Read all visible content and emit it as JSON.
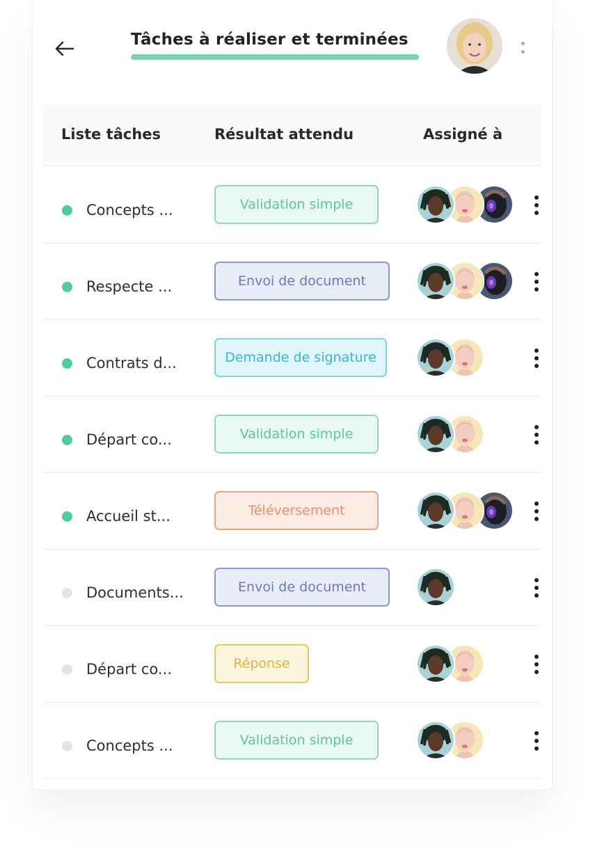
{
  "header": {
    "title": "Tâches à réaliser et terminées",
    "accent_color": "#7fd0b4"
  },
  "table": {
    "columns": [
      "Liste tâches",
      "Résultat attendu",
      "Assigné à"
    ],
    "rows": [
      {
        "task": "Concepts ...",
        "status": "done",
        "result": "Validation simple",
        "badge_color": "green",
        "assignees": [
          "man",
          "woman",
          "robot"
        ]
      },
      {
        "task": "Respecte ...",
        "status": "done",
        "result": "Envoi de document",
        "badge_color": "blue",
        "assignees": [
          "man",
          "woman",
          "robot"
        ]
      },
      {
        "task": "Contrats d...",
        "status": "done",
        "result": "Demande de signature",
        "badge_color": "cyan",
        "assignees": [
          "man",
          "woman"
        ]
      },
      {
        "task": "Départ co...",
        "status": "done",
        "result": "Validation simple",
        "badge_color": "green",
        "assignees": [
          "man",
          "woman"
        ]
      },
      {
        "task": "Accueil st...",
        "status": "done",
        "result": "Téléversement",
        "badge_color": "orange",
        "assignees": [
          "man",
          "woman",
          "robot"
        ]
      },
      {
        "task": "Documents...",
        "status": "pending",
        "result": "Envoi de document",
        "badge_color": "blue",
        "assignees": [
          "man"
        ]
      },
      {
        "task": "Départ co...",
        "status": "pending",
        "result": "Réponse",
        "badge_color": "yellow",
        "assignees": [
          "man",
          "woman"
        ]
      },
      {
        "task": "Concepts ...",
        "status": "pending",
        "result": "Validation simple",
        "badge_color": "green",
        "assignees": [
          "man",
          "woman"
        ]
      }
    ]
  },
  "colors": {
    "done": "#4fcb9e",
    "pending": "#e3e4e7"
  }
}
